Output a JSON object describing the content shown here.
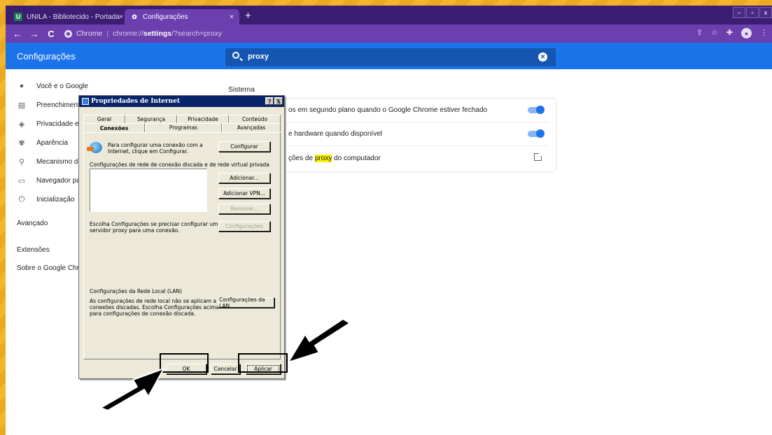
{
  "browser": {
    "tabs": [
      {
        "title": "UNILA - Bibliotecido - Portada",
        "close": "×"
      },
      {
        "title": "Configurações",
        "close": "×"
      }
    ],
    "new_tab": "+",
    "window_controls": [
      "–",
      "▫",
      "x"
    ],
    "nav": {
      "back": "←",
      "forward": "→",
      "reload": "C"
    },
    "address": {
      "scheme_label": "Chrome",
      "separator": "|",
      "host": "chrome://",
      "bold": "settings",
      "rest": "/?search=proxy"
    }
  },
  "settings": {
    "title": "Configurações",
    "search_value": "proxy",
    "sidebar": {
      "items": [
        {
          "icon": "person-icon",
          "label": "Você e o Google"
        },
        {
          "icon": "clipboard-icon",
          "label": "Preenchimento"
        },
        {
          "icon": "shield-icon",
          "label": "Privacidade e s"
        },
        {
          "icon": "palette-icon",
          "label": "Aparência"
        },
        {
          "icon": "search-icon",
          "label": "Mecanismo de"
        },
        {
          "icon": "browser-icon",
          "label": "Navegador pad"
        },
        {
          "icon": "power-icon",
          "label": "Inicialização"
        }
      ],
      "advanced": "Avançado",
      "extensions": "Extensões",
      "about": "Sobre o Google Chrom"
    },
    "section_title": "Sistema",
    "rows": [
      {
        "text": "os em segundo plano quando o Google Chrome estiver fechado",
        "control": "toggle",
        "on": true
      },
      {
        "text": "e hardware quando disponível",
        "control": "toggle",
        "on": true
      },
      {
        "pre": "ções de ",
        "highlight": "proxy",
        "post": " do computador",
        "control": "external-link"
      }
    ]
  },
  "dialog": {
    "title": "Propriedades de Internet",
    "title_buttons": [
      "?",
      "X"
    ],
    "tabs_back": [
      "Geral",
      "Segurança",
      "Privacidade",
      "Conteúdo"
    ],
    "tabs_front": [
      "Conexões",
      "Programas",
      "Avançadas"
    ],
    "setup_text_1": "Para configurar uma conexão com a",
    "setup_text_2": "Internet, clique em Configurar.",
    "configurar": "Configurar",
    "dialup_header": "Configurações de rede de conexão discada e de rede virtual privada",
    "adicionar": "Adicionar...",
    "adicionar_vpn": "Adicionar VPN...",
    "remover": "Remover...",
    "choose_text_1": "Escolha Configurações se precisar configurar um",
    "choose_text_2": "servidor proxy para uma conexão.",
    "configuracoes_btn": "Configurações",
    "lan_header": "Configurações da Rede Local (LAN)",
    "lan_text_1": "As configurações de rede local não se aplicam a",
    "lan_text_2": "conexões discadas. Escolha Configurações acima",
    "lan_text_3": "para configurações de conexão discada.",
    "lan_btn": "Configurações da LAN",
    "ok": "OK",
    "cancel": "Cancelar",
    "apply": "Aplicar"
  },
  "colors": {
    "tab_bar": "#3b1d72",
    "toolbar": "#6b3fae",
    "settings_header": "#1a73e8",
    "highlight": "#fff200",
    "page_border": "#f2b52e"
  }
}
